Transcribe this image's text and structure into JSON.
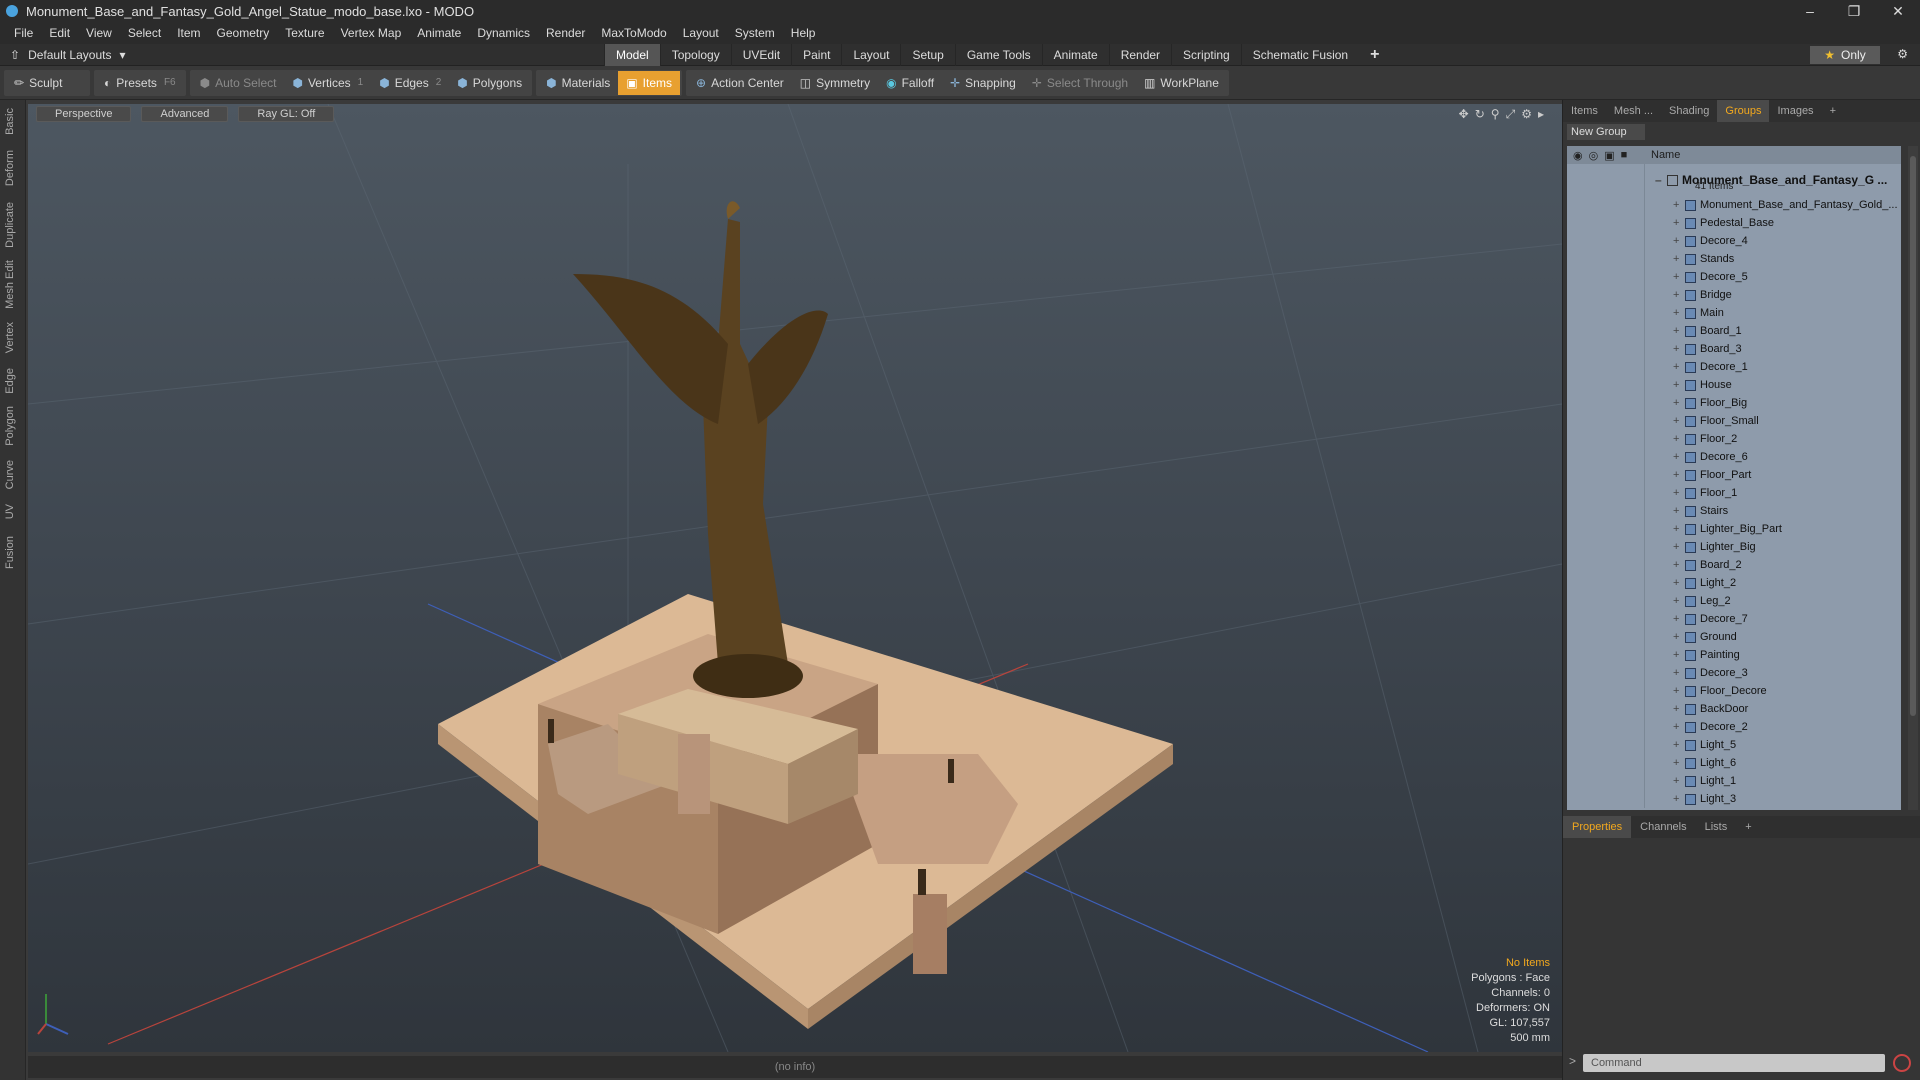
{
  "window": {
    "title": "Monument_Base_and_Fantasy_Gold_Angel_Statue_modo_base.lxo - MODO"
  },
  "menu": [
    "File",
    "Edit",
    "View",
    "Select",
    "Item",
    "Geometry",
    "Texture",
    "Vertex Map",
    "Animate",
    "Dynamics",
    "Render",
    "MaxToModo",
    "Layout",
    "System",
    "Help"
  ],
  "layout_selector": "Default Layouts",
  "layout_tabs": [
    "Model",
    "Topology",
    "UVEdit",
    "Paint",
    "Layout",
    "Setup",
    "Game Tools",
    "Animate",
    "Render",
    "Scripting",
    "Schematic Fusion"
  ],
  "active_layout_tab": "Model",
  "only_label": "Only",
  "toolbar": {
    "sculpt": "Sculpt",
    "presets": "Presets",
    "presets_key": "F6",
    "auto_select": "Auto Select",
    "vertices": "Vertices",
    "vertices_count": "1",
    "edges": "Edges",
    "edges_count": "2",
    "polygons": "Polygons",
    "materials": "Materials",
    "items": "Items",
    "action_center": "Action Center",
    "symmetry": "Symmetry",
    "falloff": "Falloff",
    "snapping": "Snapping",
    "select_through": "Select Through",
    "workplane": "WorkPlane"
  },
  "left_tabs": [
    "Basic",
    "Deform",
    "Duplicate",
    "Mesh Edit",
    "Vertex",
    "Edge",
    "Polygon",
    "Curve",
    "UV",
    "Fusion"
  ],
  "viewport": {
    "projection": "Perspective",
    "shading": "Advanced",
    "raygl": "Ray GL: Off",
    "info": {
      "selection": "No Items",
      "polygons": "Polygons : Face",
      "channels": "Channels: 0",
      "deformers": "Deformers: ON",
      "gl": "GL: 107,557",
      "scale": "500 mm"
    }
  },
  "status": "(no info)",
  "panel_tabs": [
    "Items",
    "Mesh ...",
    "Shading",
    "Groups",
    "Images"
  ],
  "active_panel_tab": "Groups",
  "new_group": "New Group",
  "list_header": "Name",
  "group": {
    "name": "Monument_Base_and_Fantasy_G ...",
    "count": "41 Items"
  },
  "items": [
    "Monument_Base_and_Fantasy_Gold_...",
    "Pedestal_Base",
    "Decore_4",
    "Stands",
    "Decore_5",
    "Bridge",
    "Main",
    "Board_1",
    "Board_3",
    "Decore_1",
    "House",
    "Floor_Big",
    "Floor_Small",
    "Floor_2",
    "Decore_6",
    "Floor_Part",
    "Floor_1",
    "Stairs",
    "Lighter_Big_Part",
    "Lighter_Big",
    "Board_2",
    "Light_2",
    "Leg_2",
    "Decore_7",
    "Ground",
    "Painting",
    "Decore_3",
    "Floor_Decore",
    "BackDoor",
    "Decore_2",
    "Light_5",
    "Light_6",
    "Light_1",
    "Light_3"
  ],
  "bottom_tabs": [
    "Properties",
    "Channels",
    "Lists"
  ],
  "active_bottom_tab": "Properties",
  "command_placeholder": "Command",
  "colors": {
    "accent": "#e8a030",
    "list_bg": "#8e9bab",
    "statue": "#5a4220",
    "base": "#d9b48f"
  }
}
